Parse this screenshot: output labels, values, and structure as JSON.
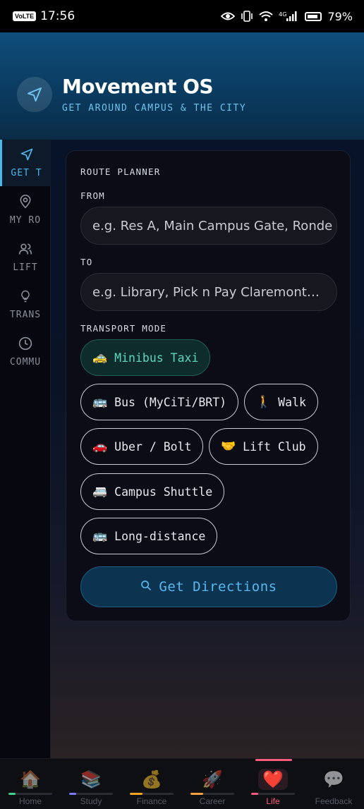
{
  "status_bar": {
    "volte": "VoLTE",
    "time": "17:56",
    "network": "4G",
    "battery": "79%"
  },
  "header": {
    "icon": "navigation-arrow-icon",
    "title": "Movement OS",
    "subtitle": "GET AROUND CAMPUS & THE CITY"
  },
  "sidebar": {
    "items": [
      {
        "label": "GET T",
        "icon": "navigation-arrow-icon",
        "active": true
      },
      {
        "label": "MY RO",
        "icon": "map-pin-icon"
      },
      {
        "label": "LIFT",
        "icon": "users-icon"
      },
      {
        "label": "TRANS",
        "icon": "lightbulb-icon"
      },
      {
        "label": "COMMU",
        "icon": "clock-icon"
      }
    ]
  },
  "route_planner": {
    "title": "ROUTE PLANNER",
    "from_label": "FROM",
    "from_placeholder": "e.g. Res A, Main Campus Gate, Ronde",
    "to_label": "TO",
    "to_placeholder": "e.g. Library, Pick n Pay Claremont…",
    "mode_label": "TRANSPORT MODE",
    "modes": [
      {
        "emoji": "🚕",
        "label": "Minibus Taxi",
        "selected": true
      },
      {
        "emoji": "🚌",
        "label": "Bus (MyCiTi/BRT)"
      },
      {
        "emoji": "🚶",
        "label": "Walk"
      },
      {
        "emoji": "🚗",
        "label": "Uber / Bolt"
      },
      {
        "emoji": "🤝",
        "label": "Lift Club"
      },
      {
        "emoji": "🚐",
        "label": "Campus Shuttle"
      },
      {
        "emoji": "🚌",
        "label": "Long-distance"
      }
    ],
    "button_label": "Get Directions",
    "button_icon": "search-icon"
  },
  "bottom_nav": {
    "items": [
      {
        "emoji": "🏠",
        "label": "Home",
        "color": "#3fcf8e"
      },
      {
        "emoji": "📚",
        "label": "Study",
        "color": "#7b7bff"
      },
      {
        "emoji": "💰",
        "label": "Finance",
        "color": "#f5a623"
      },
      {
        "emoji": "🚀",
        "label": "Career",
        "color": "#f59e42"
      },
      {
        "emoji": "❤️",
        "label": "Life",
        "color": "#ff5b7a",
        "active": true
      },
      {
        "emoji": "💬",
        "label": "Feedback",
        "color": "#2a2b33"
      }
    ]
  },
  "colors": {
    "accent": "#4fb6ea",
    "selected_mode": "#5fd6ba",
    "active_tab": "#ff5b7a"
  }
}
